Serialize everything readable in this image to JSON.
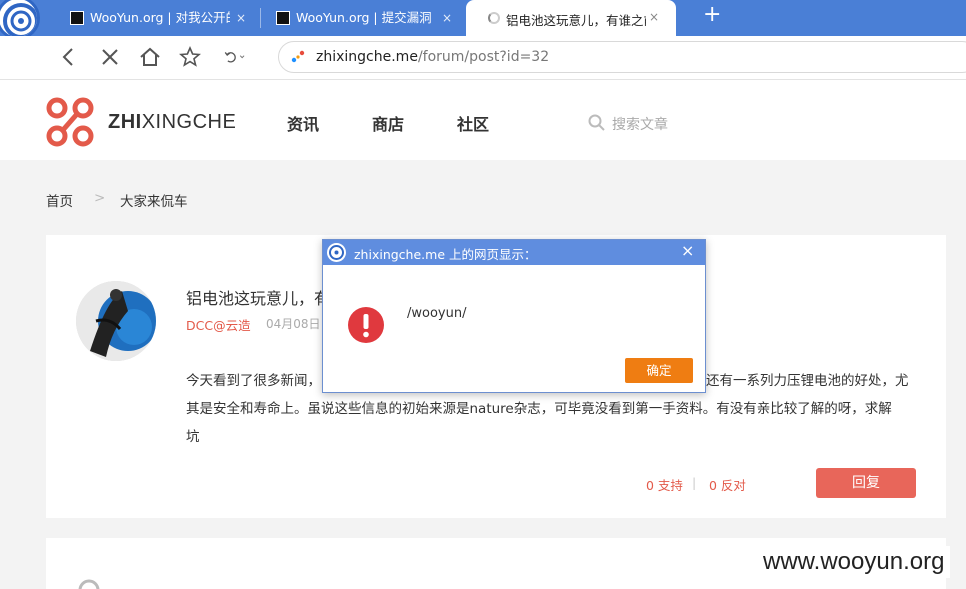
{
  "browser": {
    "tabs": [
      {
        "title": "WooYun.org | 对我公开的"
      },
      {
        "title": "WooYun.org | 提交漏洞"
      },
      {
        "title": "铝电池这玩意儿，有谁之前"
      }
    ],
    "tab_close": "×",
    "new_tab": "+",
    "url_domain": "zhixingche.me",
    "url_path": "/forum/post?id=32"
  },
  "site": {
    "brand_bold": "ZHI",
    "brand_rest": "XINGCHE",
    "nav": [
      "资讯",
      "商店",
      "社区"
    ],
    "search_placeholder": "搜索文章",
    "accent": "#e35a4a"
  },
  "breadcrumb": {
    "home": "首页",
    "separator": ">",
    "current": "大家来侃车"
  },
  "post": {
    "title": "铝电池这玩意儿，有",
    "author": "DCC@云造",
    "date": "04月08日",
    "body_lines": [
      "今天看到了很多新闻，",
      "还有一系列力压锂电池的好处，尤",
      "其是安全和寿命上。虽说这些信息的初始来源是nature杂志，可毕竟没看到第一手资料。有没有亲比较了解的呀，求解",
      "坑"
    ],
    "support": "0 支持",
    "vote_sep": "|",
    "oppose": "0 反对",
    "reply_label": "回复"
  },
  "dialog": {
    "title": "zhixingche.me 上的网页显示：",
    "close": "×",
    "message": "/wooyun/",
    "ok_label": "确定",
    "titlebar_color": "#5f8ddf",
    "button_color": "#ef7d12"
  },
  "watermark": "www.wooyun.org"
}
